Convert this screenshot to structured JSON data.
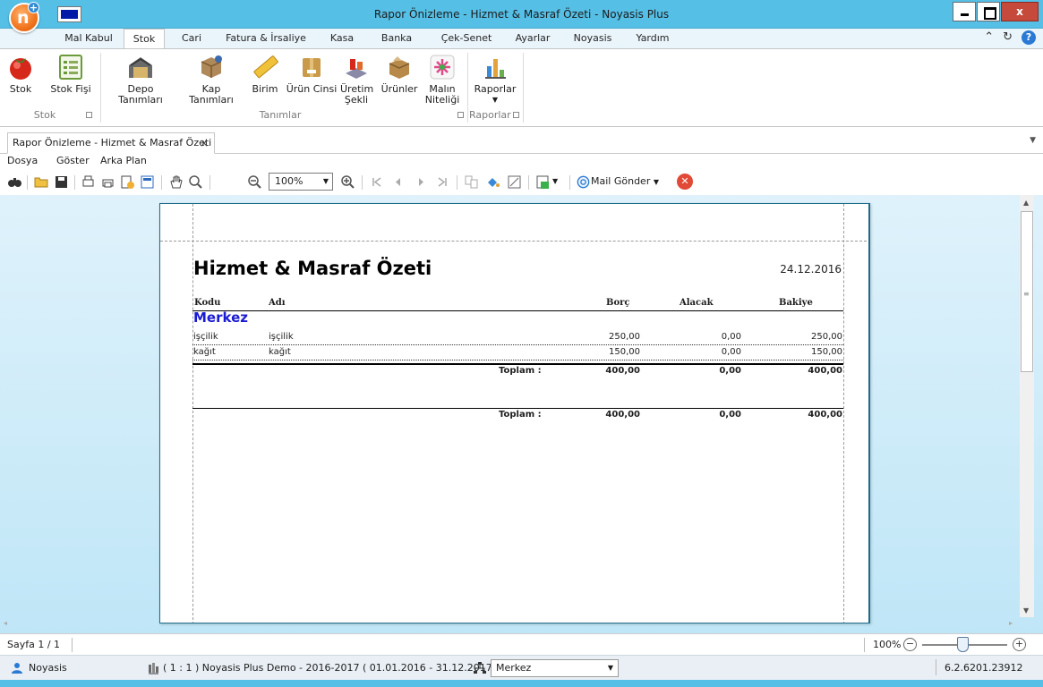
{
  "window": {
    "title": "Rapor Önizleme - Hizmet & Masraf Özeti - Noyasis Plus"
  },
  "ribbon_tabs": [
    "Mal Kabul",
    "Stok",
    "Cari",
    "Fatura & İrsaliye",
    "Kasa",
    "Banka",
    "Çek-Senet",
    "Ayarlar",
    "Noyasis",
    "Yardım"
  ],
  "ribbon_active_tab": "Stok",
  "ribbon": {
    "buttons": [
      {
        "label": "Stok",
        "icon": "tomato-icon"
      },
      {
        "label": "Stok Fişi",
        "icon": "list-document-icon"
      },
      {
        "label": "Depo Tanımları",
        "icon": "warehouse-icon"
      },
      {
        "label": "Kap Tanımları",
        "icon": "box-icon"
      },
      {
        "label": "Birim",
        "icon": "ruler-icon"
      },
      {
        "label": "Ürün Cinsi",
        "icon": "package-icon"
      },
      {
        "label": "Üretim\nŞekli",
        "icon": "production-icon"
      },
      {
        "label": "Ürünler",
        "icon": "products-icon"
      },
      {
        "label": "Malın\nNiteliği",
        "icon": "quality-icon"
      },
      {
        "label": "Raporlar",
        "icon": "bar-chart-icon"
      }
    ],
    "groups": [
      "Stok",
      "Tanımlar",
      "Raporlar"
    ]
  },
  "document_tab": {
    "label": "Rapor Önizleme - Hizmet & Masraf Özeti",
    "close": "×"
  },
  "preview_menu": [
    "Dosya",
    "Göster",
    "Arka Plan"
  ],
  "toolbar": {
    "zoom": "100%",
    "mail_send": "Mail Gönder"
  },
  "report": {
    "title": "Hizmet & Masraf Özeti",
    "date": "24.12.2016",
    "columns": {
      "code": "Kodu",
      "name": "Adı",
      "debit": "Borç",
      "credit": "Alacak",
      "balance": "Bakiye"
    },
    "group": "Merkez",
    "rows": [
      {
        "code": "işçilik",
        "name": "işçilik",
        "debit": "250,00",
        "credit": "0,00",
        "balance": "250,00"
      },
      {
        "code": "kağıt",
        "name": "kağıt",
        "debit": "150,00",
        "credit": "0,00",
        "balance": "150,00"
      }
    ],
    "group_total": {
      "label": "Toplam :",
      "debit": "400,00",
      "credit": "0,00",
      "balance": "400,00"
    },
    "grand_total": {
      "label": "Toplam :",
      "debit": "400,00",
      "credit": "0,00",
      "balance": "400,00"
    }
  },
  "status": {
    "page": "Sayfa 1 / 1",
    "zoom": "100%",
    "user": "Noyasis",
    "company": "( 1 : 1 )  Noyasis Plus Demo - 2016-2017  ( 01.01.2016 - 31.12.2017 )",
    "branch": "Merkez",
    "version": "6.2.6201.23912"
  },
  "colors": {
    "titlebar": "#55bfe6",
    "group_text": "#1b1bd4",
    "close_button": "#c64a3c"
  }
}
